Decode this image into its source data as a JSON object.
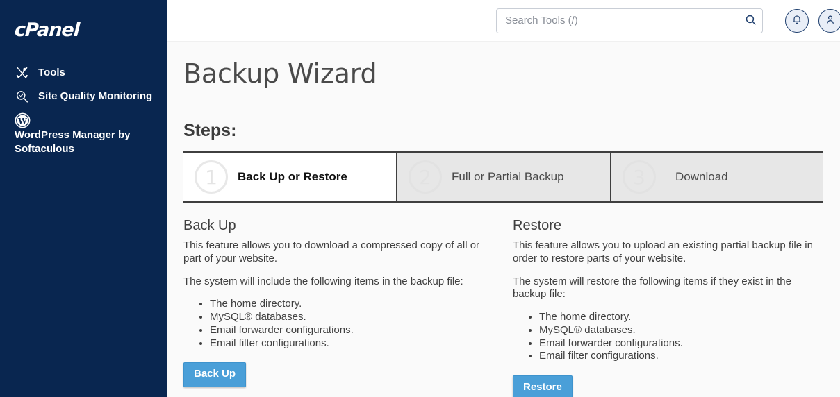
{
  "sidebar": {
    "logo_text": "cPanel",
    "items": [
      {
        "label": "Tools",
        "icon": "tools-icon"
      },
      {
        "label": "Site Quality Monitoring",
        "icon": "site-quality-icon"
      },
      {
        "label": "WordPress Manager by Softaculous",
        "icon": "wordpress-icon"
      }
    ]
  },
  "topbar": {
    "search_placeholder": "Search Tools (/)",
    "search_value": "",
    "search_icon": "search-icon",
    "notifications_icon": "bell-icon",
    "account_icon": "user-icon"
  },
  "page": {
    "title": "Backup Wizard",
    "steps_heading": "Steps:"
  },
  "steps": [
    {
      "number": "1",
      "label": "Back Up or Restore",
      "active": true
    },
    {
      "number": "2",
      "label": "Full or Partial Backup",
      "active": false
    },
    {
      "number": "3",
      "label": "Download",
      "active": false
    }
  ],
  "backup": {
    "heading": "Back Up",
    "paragraph1": "This feature allows you to download a compressed copy of all or part of your website.",
    "paragraph2": "The system will include the following items in the backup file:",
    "items": [
      "The home directory.",
      "MySQL® databases.",
      "Email forwarder configurations.",
      "Email filter configurations."
    ],
    "button_label": "Back Up"
  },
  "restore": {
    "heading": "Restore",
    "paragraph1": "This feature allows you to upload an existing partial backup file in order to restore parts of your website.",
    "paragraph2": "The system will restore the following items if they exist in the backup file:",
    "items": [
      "The home directory.",
      "MySQL® databases.",
      "Email forwarder configurations.",
      "Email filter configurations."
    ],
    "button_label": "Restore"
  },
  "colors": {
    "sidebar_bg": "#092650",
    "button_blue": "#4a9fd8",
    "step_border": "#3f3f3f",
    "inactive_step_bg": "#e7e7e7"
  }
}
